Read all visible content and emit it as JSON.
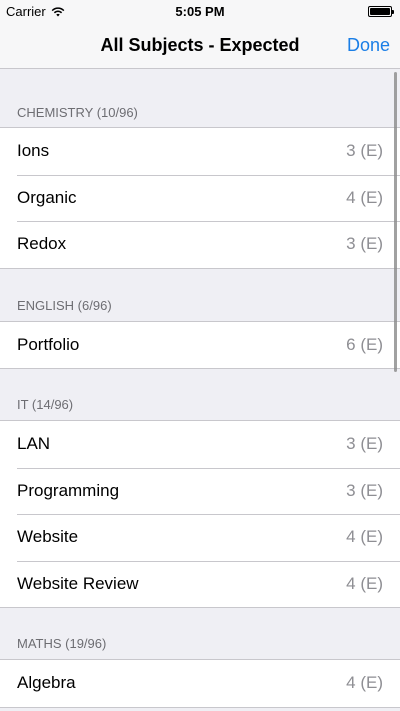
{
  "status": {
    "carrier": "Carrier",
    "time": "5:05 PM"
  },
  "nav": {
    "title": "All Subjects - Expected",
    "done": "Done"
  },
  "sections": [
    {
      "header": "CHEMISTRY (10/96)",
      "rows": [
        {
          "label": "Ions",
          "value": "3 (E)"
        },
        {
          "label": "Organic",
          "value": "4 (E)"
        },
        {
          "label": "Redox",
          "value": "3 (E)"
        }
      ]
    },
    {
      "header": "ENGLISH (6/96)",
      "rows": [
        {
          "label": "Portfolio",
          "value": "6 (E)"
        }
      ]
    },
    {
      "header": "IT (14/96)",
      "rows": [
        {
          "label": "LAN",
          "value": "3 (E)"
        },
        {
          "label": "Programming",
          "value": "3 (E)"
        },
        {
          "label": "Website",
          "value": "4 (E)"
        },
        {
          "label": "Website Review",
          "value": "4 (E)"
        }
      ]
    },
    {
      "header": "MATHS (19/96)",
      "rows": [
        {
          "label": "Algebra",
          "value": "4 (E)"
        }
      ]
    }
  ]
}
